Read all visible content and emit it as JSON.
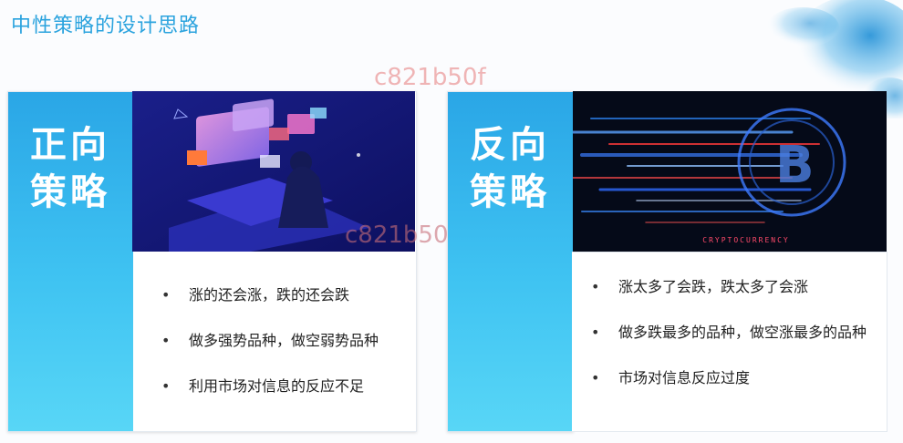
{
  "page": {
    "title": "中性策略的设计思路",
    "watermark": "c821b50f"
  },
  "left": {
    "side_label": "正向策略",
    "bullets": [
      "涨的还会涨，跌的还会跌",
      "做多强势品种，做空弱势品种",
      "利用市场对信息的反应不足"
    ]
  },
  "right": {
    "side_label": "反向策略",
    "image_caption": "CRYPTOCURRENCY",
    "bullets": [
      "涨太多了会跌，跌太多了会涨",
      "做多跌最多的品种，做空涨最多的品种",
      "市场对信息反应过度"
    ]
  },
  "colors": {
    "accent": "#2ba3de",
    "side_top": "#2aa6e6",
    "side_bottom": "#58d6f6"
  }
}
